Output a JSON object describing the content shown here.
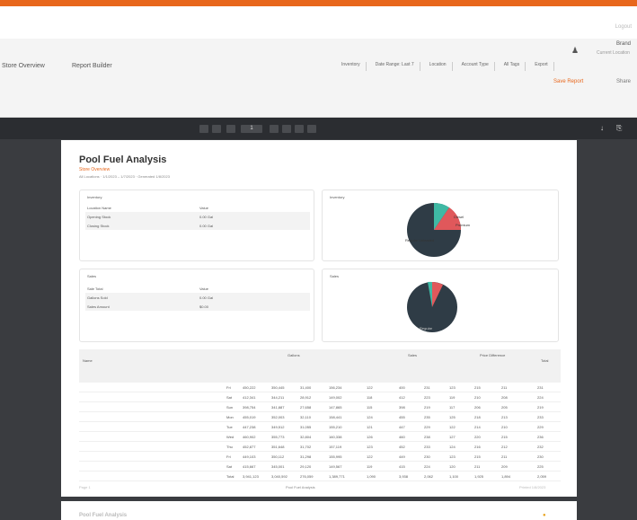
{
  "header": {
    "ghost_text": "Logout",
    "user": {
      "name": "Brand",
      "subtitle": "Current Location"
    },
    "actions": {
      "primary": "Save Report",
      "secondary": "Share"
    }
  },
  "nav": {
    "links": [
      "Store Overview",
      "Report Builder"
    ]
  },
  "filters": [
    "Inventory",
    "Date Range: Last 7",
    "Location",
    "Account Type",
    "All Tags",
    "Export"
  ],
  "viewer": {
    "page_number": "1",
    "page_total": "of 3"
  },
  "report": {
    "title": "Pool Fuel Analysis",
    "subtitle": "Store Overview",
    "meta": "All Locations · 1/1/2023 – 1/7/2023 · Generated 1/8/2023",
    "card1": {
      "title": "Inventory",
      "rows": [
        {
          "label": "Location Name",
          "value": "Value"
        },
        {
          "label": "Opening Stock",
          "value": "0.00 Gal"
        },
        {
          "label": "Closing Stock",
          "value": "0.00 Gal"
        }
      ]
    },
    "card2": {
      "title": "Inventory"
    },
    "card3": {
      "title": "Sales",
      "rows": [
        {
          "label": "Sale Total",
          "value": "Value"
        },
        {
          "label": "Gallons Sold",
          "value": "0.00 Gal"
        },
        {
          "label": "Sales Amount",
          "value": "$0.00"
        }
      ]
    },
    "card4": {
      "title": "Sales"
    },
    "pie1": {
      "labels": [
        "Diesel",
        "Premium",
        "Regular Unleaded"
      ]
    },
    "pie2": {
      "labels": [
        "Regular"
      ]
    },
    "table": {
      "headers": {
        "name": "Name",
        "group1": "Gallons",
        "group2": "Sales",
        "group3": "Price Difference",
        "total": "Total"
      },
      "rows": [
        [
          "Fri",
          "450,222",
          "350,445",
          "31,400",
          "156,234",
          "122",
          "400",
          "231",
          "123",
          "215",
          "211",
          "231"
        ],
        [
          "Sat",
          "412,341",
          "344,211",
          "28,912",
          "149,002",
          "118",
          "412",
          "223",
          "119",
          "210",
          "208",
          "224"
        ],
        [
          "Sun",
          "398,754",
          "341,887",
          "27,658",
          "147,865",
          "115",
          "398",
          "219",
          "117",
          "206",
          "205",
          "219"
        ],
        [
          "Mon",
          "455,019",
          "352,003",
          "32,110",
          "158,441",
          "124",
          "455",
          "235",
          "125",
          "218",
          "213",
          "233"
        ],
        [
          "Tue",
          "447,238",
          "349,512",
          "31,055",
          "155,210",
          "121",
          "447",
          "229",
          "122",
          "214",
          "210",
          "229"
        ],
        [
          "Wed",
          "460,902",
          "355,773",
          "32,804",
          "160,338",
          "126",
          "460",
          "238",
          "127",
          "220",
          "215",
          "236"
        ],
        [
          "Thu",
          "452,877",
          "351,648",
          "31,702",
          "157,119",
          "123",
          "452",
          "233",
          "124",
          "216",
          "212",
          "232"
        ],
        [
          "Fri",
          "449,103",
          "350,112",
          "31,298",
          "155,995",
          "122",
          "449",
          "230",
          "123",
          "215",
          "211",
          "230"
        ],
        [
          "Sat",
          "415,667",
          "345,001",
          "29,120",
          "149,567",
          "119",
          "415",
          "224",
          "120",
          "211",
          "209",
          "225"
        ],
        [
          "Total",
          "3,941,123",
          "3,040,592",
          "276,059",
          "1,389,771",
          "1,090",
          "3,938",
          "2,062",
          "1,100",
          "1,925",
          "1,894",
          "2,059"
        ]
      ]
    },
    "footer": {
      "left": "Page 1",
      "mid": "Pool Fuel Analysis",
      "right": "Printed 1/8/2023"
    }
  },
  "page2": {
    "title": "Pool Fuel Analysis"
  },
  "colors": {
    "accent": "#e8671c",
    "teal": "#3fb9a4",
    "red": "#e0585b",
    "dark": "#2f3c46"
  }
}
